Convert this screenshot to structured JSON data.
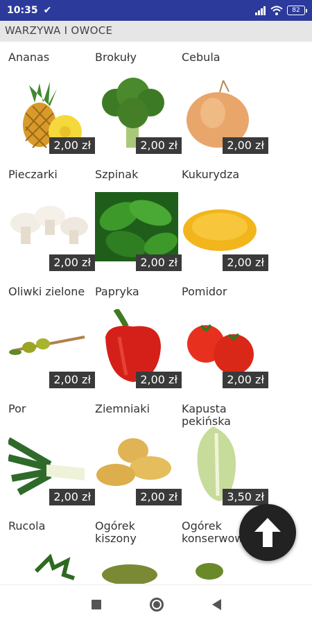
{
  "status_bar": {
    "time": "10:35",
    "battery": "82"
  },
  "title": "WARZYWA I OWOCE",
  "products": [
    {
      "name": "Ananas",
      "price": "2,00 zł",
      "icon": "pineapple-icon"
    },
    {
      "name": "Brokuły",
      "price": "2,00 zł",
      "icon": "broccoli-icon"
    },
    {
      "name": "Cebula",
      "price": "2,00 zł",
      "icon": "onion-icon"
    },
    {
      "name": "Pieczarki",
      "price": "2,00 zł",
      "icon": "mushrooms-icon"
    },
    {
      "name": "Szpinak",
      "price": "2,00 zł",
      "icon": "spinach-icon"
    },
    {
      "name": "Kukurydza",
      "price": "2,00 zł",
      "icon": "corn-icon"
    },
    {
      "name": "Oliwki zielone",
      "price": "2,00 zł",
      "icon": "olives-icon"
    },
    {
      "name": "Papryka",
      "price": "2,00 zł",
      "icon": "pepper-icon"
    },
    {
      "name": "Pomidor",
      "price": "2,00 zł",
      "icon": "tomato-icon"
    },
    {
      "name": "Por",
      "price": "2,00 zł",
      "icon": "leek-icon"
    },
    {
      "name": "Ziemniaki",
      "price": "2,00 zł",
      "icon": "potatoes-icon"
    },
    {
      "name": "Kapusta pekińska",
      "price": "3,50 zł",
      "icon": "cabbage-icon"
    },
    {
      "name": "Rucola",
      "price": "",
      "icon": "rucola-icon"
    },
    {
      "name": "Ogórek kiszony",
      "price": "",
      "icon": "pickled-cucumber-icon"
    },
    {
      "name": "Ogórek konserwowy",
      "price": "",
      "icon": "canned-cucumber-icon"
    }
  ],
  "colors": {
    "status_bar": "#2b3a9b",
    "price_tag": "#3a3a3a",
    "fab": "#222222"
  }
}
